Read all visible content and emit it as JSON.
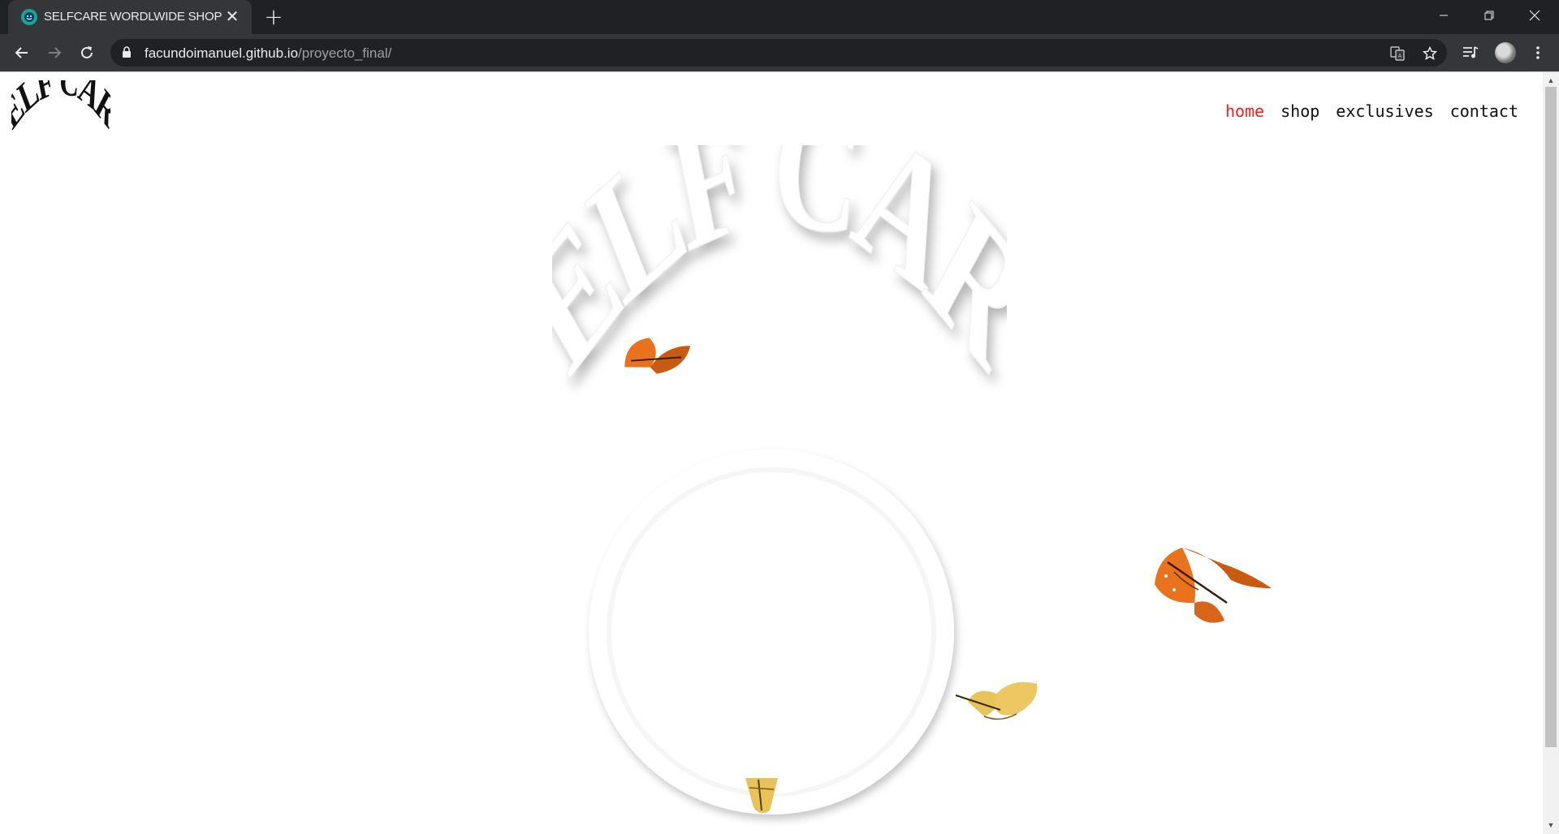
{
  "browser": {
    "tab": {
      "title": "SELFCARE WORDLWIDE SHOP",
      "close_glyph": "✕"
    },
    "new_tab_glyph": "+",
    "address": {
      "host": "facundoimanuel.github.io",
      "path": "/proyecto_final/"
    },
    "icons": [
      "back-arrow-icon",
      "forward-arrow-icon",
      "reload-icon",
      "lock-icon",
      "translate-icon",
      "star-icon",
      "media-control-icon",
      "profile-avatar",
      "more-menu-icon",
      "minimize-icon",
      "restore-icon",
      "close-window-icon"
    ]
  },
  "site": {
    "logo_text": "SELF CARE",
    "nav": [
      {
        "label": "home",
        "active": true
      },
      {
        "label": "shop",
        "active": false
      },
      {
        "label": "exclusives",
        "active": false
      },
      {
        "label": "contact",
        "active": false
      }
    ],
    "hero": {
      "wordmark": "SELF CARE",
      "graphic": "smiley-face-emboss"
    },
    "decorations": [
      "orange-butterfly",
      "orange-butterfly",
      "yellow-butterfly",
      "yellow-butterfly"
    ]
  },
  "colors": {
    "chrome_dark": "#202124",
    "chrome_toolbar": "#35363a",
    "nav_active": "#ff1a1a",
    "nav_text": "#111111",
    "butterfly_orange": "#e8731c",
    "butterfly_yellow": "#e8c35a"
  }
}
